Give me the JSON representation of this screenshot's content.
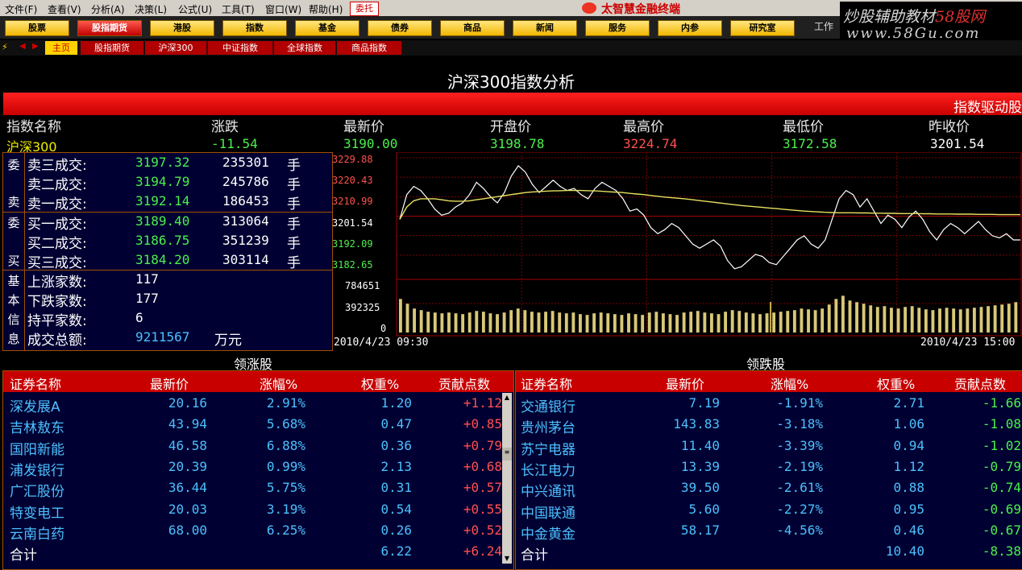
{
  "menu": [
    "文件(F)",
    "查看(V)",
    "分析(A)",
    "决策(L)",
    "公式(U)",
    "工具(T)",
    "窗口(W)",
    "帮助(H)"
  ],
  "menu_weituo": "委托",
  "brand": "太智慧金融终端",
  "toolbar": [
    "股票",
    "股指期货",
    "港股",
    "指数",
    "基金",
    "债券",
    "商品",
    "新闻",
    "服务",
    "内参",
    "研究室"
  ],
  "toolbar_work": "工作",
  "watermark_line1_a": "炒股辅助教材",
  "watermark_line1_b": "58股网",
  "watermark_line2": "www.58Gu.com",
  "tabs": [
    "主页",
    "股指期货",
    "沪深300",
    "中证指数",
    "全球指数",
    "商品指数"
  ],
  "page_title": "沪深300指数分析",
  "driver_label": "指数驱动股",
  "quote": {
    "headers": [
      "指数名称",
      "涨跌",
      "最新价",
      "开盘价",
      "最高价",
      "最低价",
      "昨收价"
    ],
    "values": [
      "沪深300",
      "-11.54",
      "3190.00",
      "3198.78",
      "3224.74",
      "3172.58",
      "3201.54"
    ],
    "colors": [
      "#f0f000",
      "#4cf04c",
      "#4cf04c",
      "#4cf04c",
      "#ff5050",
      "#4cf04c",
      "#ffffff"
    ]
  },
  "book": {
    "side_sell": [
      "委",
      "卖"
    ],
    "side_buy": [
      "委",
      "买"
    ],
    "side_info": [
      "基",
      "本",
      "信",
      "息"
    ],
    "sell": [
      {
        "label": "卖三成交:",
        "price": "3197.32",
        "vol": "235301",
        "unit": "手"
      },
      {
        "label": "卖二成交:",
        "price": "3194.79",
        "vol": "245786",
        "unit": "手"
      },
      {
        "label": "卖一成交:",
        "price": "3192.14",
        "vol": "186453",
        "unit": "手"
      }
    ],
    "buy": [
      {
        "label": "买一成交:",
        "price": "3189.40",
        "vol": "313064",
        "unit": "手"
      },
      {
        "label": "买二成交:",
        "price": "3186.75",
        "vol": "351239",
        "unit": "手"
      },
      {
        "label": "买三成交:",
        "price": "3184.20",
        "vol": "303114",
        "unit": "手"
      }
    ],
    "info": [
      {
        "label": "上涨家数:",
        "value": "117"
      },
      {
        "label": "下跌家数:",
        "value": "177"
      },
      {
        "label": "持平家数:",
        "value": "6"
      },
      {
        "label": "成交总额:",
        "value": "9211567",
        "unit": "万元"
      }
    ]
  },
  "chart_data": {
    "type": "line",
    "y_ticks": [
      "3229.88",
      "3220.43",
      "3210.99",
      "3201.54",
      "3192.09",
      "3182.65"
    ],
    "y_tick_colors": [
      "#ff5050",
      "#ff5050",
      "#ff5050",
      "#ffffff",
      "#4cf04c",
      "#4cf04c"
    ],
    "ylim": [
      3173.2,
      3229.88
    ],
    "ref_close": 3201.54,
    "vol_ticks": [
      "784651",
      "392325",
      "0"
    ],
    "vol_max": 1000000,
    "x_start": "2010/4/23 09:30",
    "x_end": "2010/4/23 15:00",
    "series": [
      {
        "values": [
          3200,
          3212,
          3216,
          3214,
          3210,
          3205,
          3202,
          3203,
          3206,
          3208,
          3212,
          3218,
          3215,
          3211,
          3208,
          3213,
          3221,
          3226,
          3223,
          3217,
          3213,
          3216,
          3219,
          3216,
          3214,
          3215,
          3212,
          3210,
          3215,
          3218,
          3216,
          3214,
          3210,
          3204,
          3205,
          3202,
          3196,
          3193,
          3195,
          3198,
          3196,
          3192,
          3188,
          3186,
          3188,
          3190,
          3187,
          3180,
          3176,
          3177,
          3180,
          3183,
          3182,
          3179,
          3178,
          3182,
          3186,
          3190,
          3192,
          3188,
          3186,
          3190,
          3200,
          3210,
          3214,
          3212,
          3206,
          3210,
          3204,
          3198,
          3202,
          3200,
          3196,
          3201,
          3204,
          3200,
          3194,
          3190,
          3195,
          3198,
          3196,
          3193,
          3196,
          3199,
          3195,
          3192,
          3191,
          3193,
          3190,
          3190
        ]
      },
      {
        "values": [
          3200,
          3206,
          3209,
          3210,
          3210,
          3210,
          3209.5,
          3209,
          3208.8,
          3208.8,
          3209,
          3209.5,
          3210,
          3210.5,
          3211,
          3211.5,
          3212,
          3212.5,
          3213,
          3213.3,
          3213.5,
          3213.7,
          3213.8,
          3213.9,
          3214,
          3214,
          3214,
          3213.9,
          3213.8,
          3213.6,
          3213.4,
          3213.2,
          3213,
          3212.6,
          3212.3,
          3212,
          3211.6,
          3211.2,
          3210.8,
          3210.5,
          3210.2,
          3209.9,
          3209.5,
          3209.1,
          3208.7,
          3208.3,
          3207.9,
          3207.5,
          3207.1,
          3206.7,
          3206.4,
          3206.1,
          3205.8,
          3205.5,
          3205.2,
          3204.9,
          3204.6,
          3204.3,
          3204,
          3203.8,
          3203.6,
          3203.4,
          3203.3,
          3203.2,
          3203.2,
          3203.2,
          3203.1,
          3203.1,
          3203,
          3203,
          3202.9,
          3202.9,
          3202.8,
          3202.8,
          3202.8,
          3202.7,
          3202.7,
          3202.6,
          3202.6,
          3202.6,
          3202.5,
          3202.5,
          3202.5,
          3202.4,
          3202.4,
          3202.4,
          3202.3,
          3202.3,
          3202.3,
          3202.3
        ]
      }
    ],
    "volume": [
      420000,
      360000,
      300000,
      280000,
      260000,
      250000,
      240000,
      250000,
      240000,
      230000,
      250000,
      270000,
      260000,
      240000,
      230000,
      250000,
      280000,
      300000,
      280000,
      260000,
      250000,
      260000,
      270000,
      250000,
      240000,
      250000,
      230000,
      220000,
      240000,
      250000,
      240000,
      230000,
      220000,
      240000,
      230000,
      220000,
      250000,
      260000,
      240000,
      230000,
      220000,
      250000,
      260000,
      270000,
      250000,
      240000,
      230000,
      260000,
      280000,
      270000,
      250000,
      240000,
      230000,
      240000,
      250000,
      260000,
      270000,
      280000,
      300000,
      290000,
      280000,
      300000,
      350000,
      420000,
      460000,
      400000,
      380000,
      360000,
      340000,
      320000,
      330000,
      310000,
      300000,
      320000,
      330000,
      310000,
      290000,
      280000,
      300000,
      310000,
      300000,
      290000,
      300000,
      310000,
      320000,
      330000,
      340000,
      350000,
      360000,
      380000
    ]
  },
  "gainers": {
    "title": "领涨股",
    "headers": [
      "证券名称",
      "最新价",
      "涨幅%",
      "权重%",
      "贡献点数"
    ],
    "rows": [
      [
        "深发展A",
        "20.16",
        "2.91%",
        "1.20",
        "+1.12"
      ],
      [
        "吉林敖东",
        "43.94",
        "5.68%",
        "0.47",
        "+0.85"
      ],
      [
        "国阳新能",
        "46.58",
        "6.88%",
        "0.36",
        "+0.79"
      ],
      [
        "浦发银行",
        "20.39",
        "0.99%",
        "2.13",
        "+0.68"
      ],
      [
        "广汇股份",
        "36.44",
        "5.75%",
        "0.31",
        "+0.57"
      ],
      [
        "特变电工",
        "20.03",
        "3.19%",
        "0.54",
        "+0.55"
      ],
      [
        "云南白药",
        "68.00",
        "6.25%",
        "0.26",
        "+0.52"
      ]
    ],
    "total_label": "合计",
    "total_weight": "6.22",
    "total_points": "+6.24"
  },
  "losers": {
    "title": "领跌股",
    "headers": [
      "证券名称",
      "最新价",
      "涨幅%",
      "权重%",
      "贡献点数"
    ],
    "rows": [
      [
        "交通银行",
        "7.19",
        "-1.91%",
        "2.71",
        "-1.66"
      ],
      [
        "贵州茅台",
        "143.83",
        "-3.18%",
        "1.06",
        "-1.08"
      ],
      [
        "苏宁电器",
        "11.40",
        "-3.39%",
        "0.94",
        "-1.02"
      ],
      [
        "长江电力",
        "13.39",
        "-2.19%",
        "1.12",
        "-0.79"
      ],
      [
        "中兴通讯",
        "39.50",
        "-2.61%",
        "0.88",
        "-0.74"
      ],
      [
        "中国联通",
        "5.60",
        "-2.27%",
        "0.95",
        "-0.69"
      ],
      [
        "中金黄金",
        "58.17",
        "-4.56%",
        "0.46",
        "-0.67"
      ]
    ],
    "total_label": "合计",
    "total_weight": "10.40",
    "total_points": "-8.38"
  },
  "colors": {
    "up": "#ff5050",
    "down": "#4cf04c",
    "name": "#4cc0ff",
    "accent_red": "#c80000",
    "border": "#a05000"
  }
}
